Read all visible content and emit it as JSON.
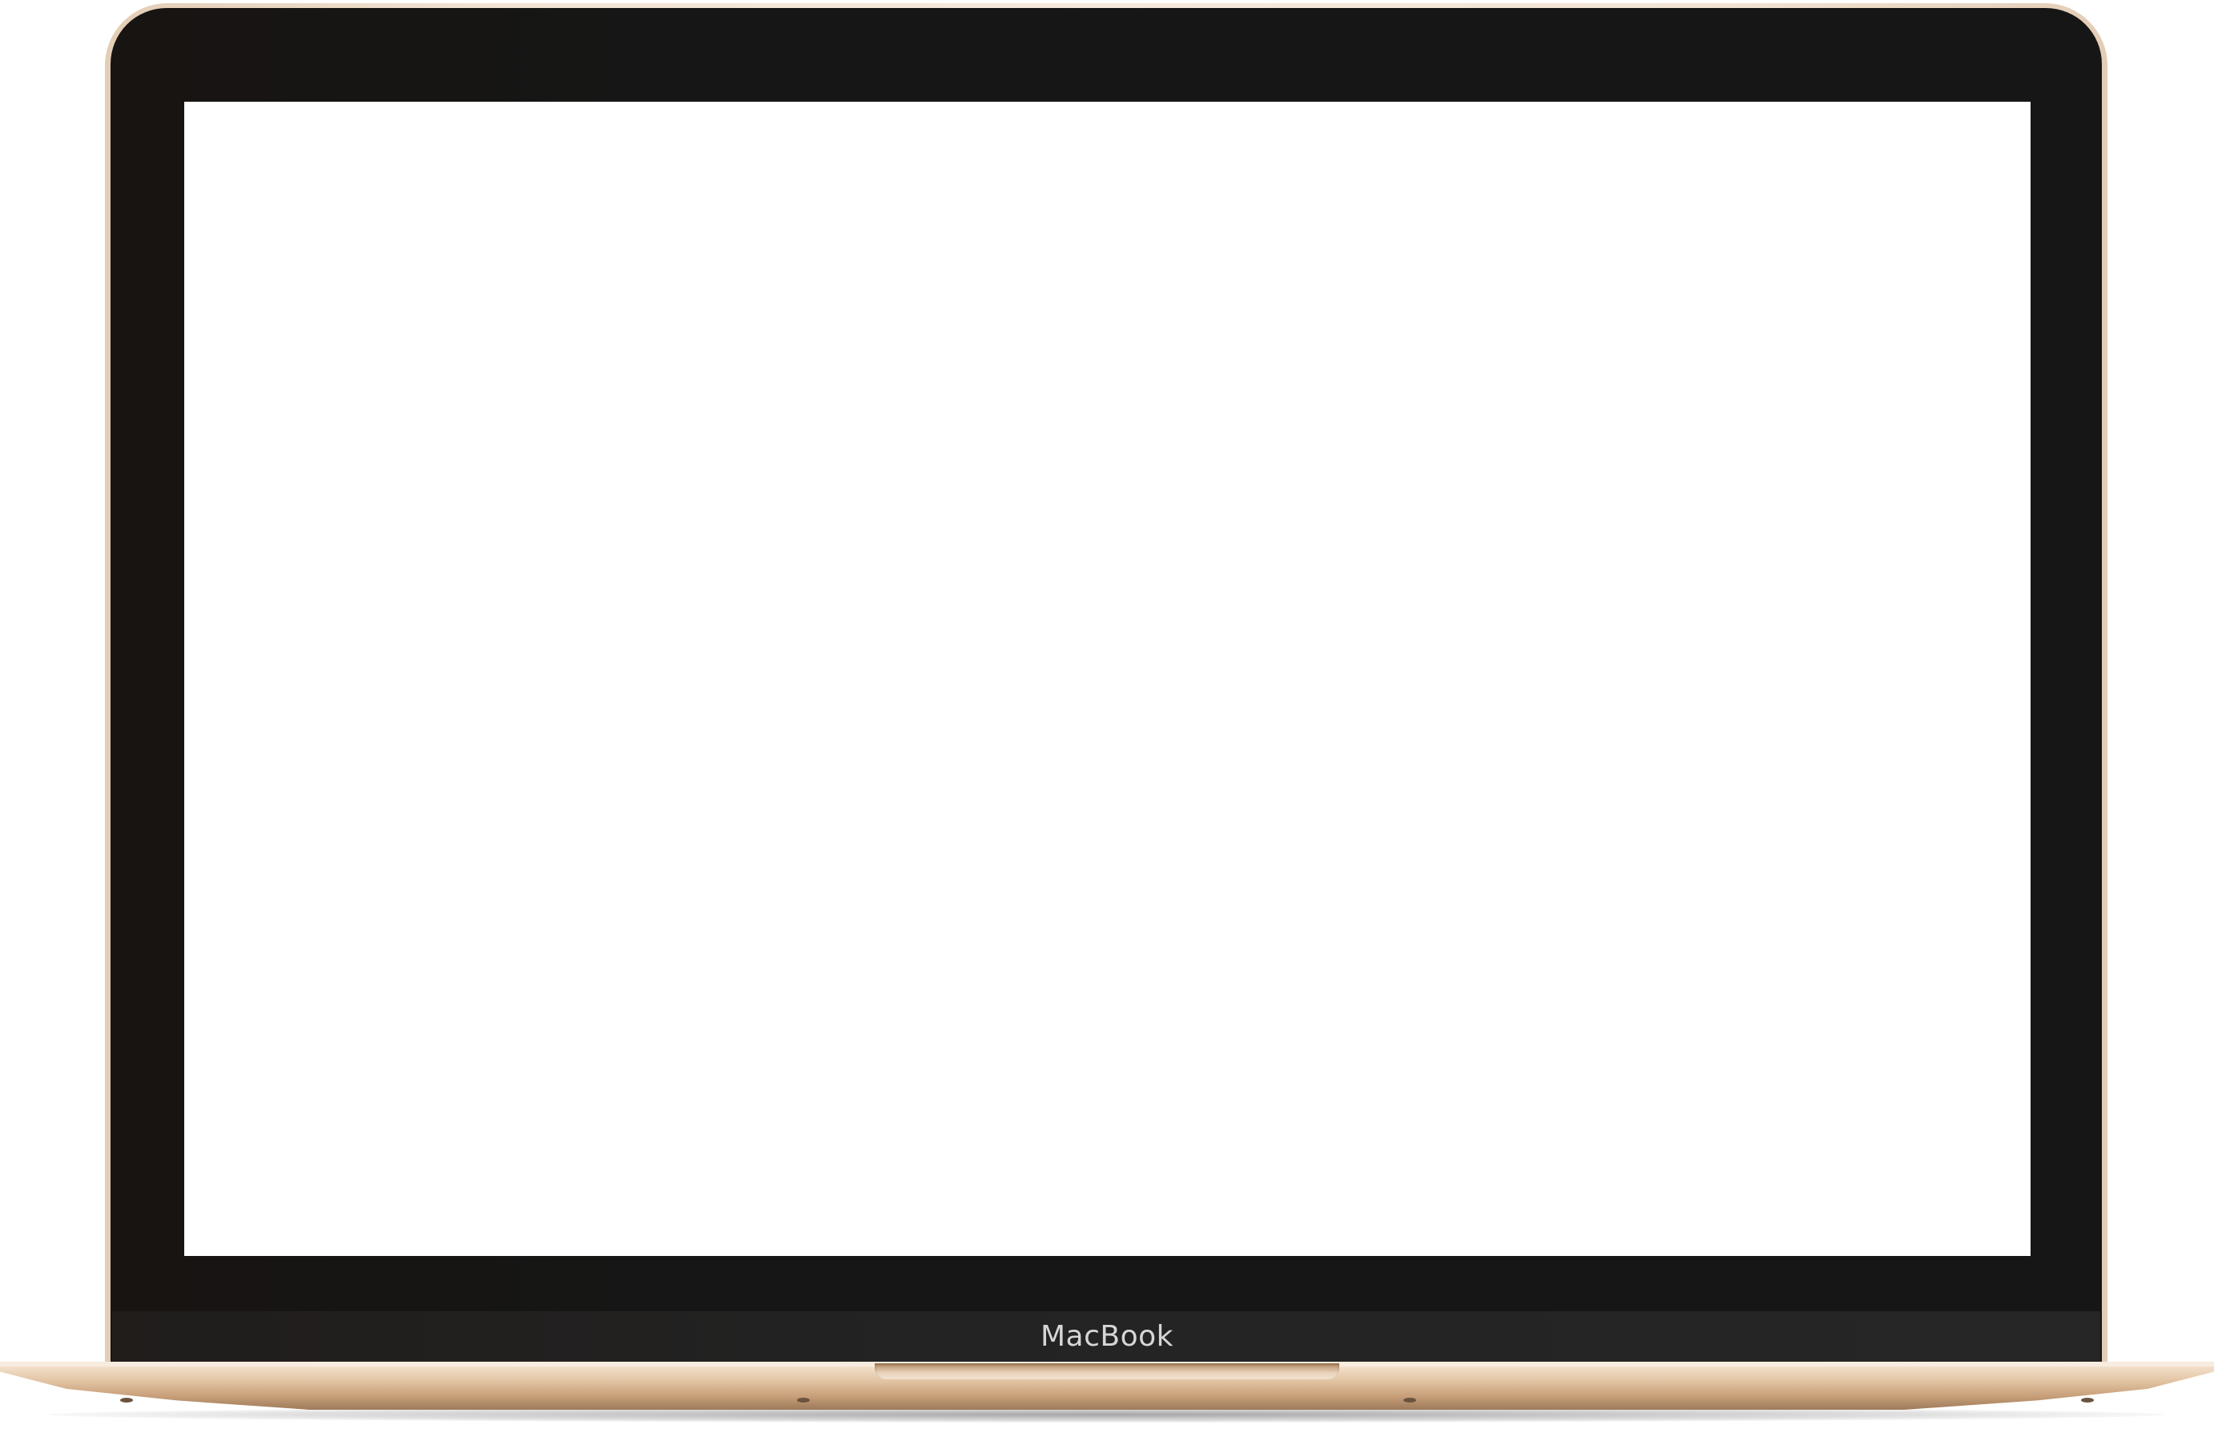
{
  "device": {
    "label": "MacBook",
    "bezel_color": "#161616",
    "body_color": "#e9d3bb",
    "screen_color": "#ffffff"
  }
}
